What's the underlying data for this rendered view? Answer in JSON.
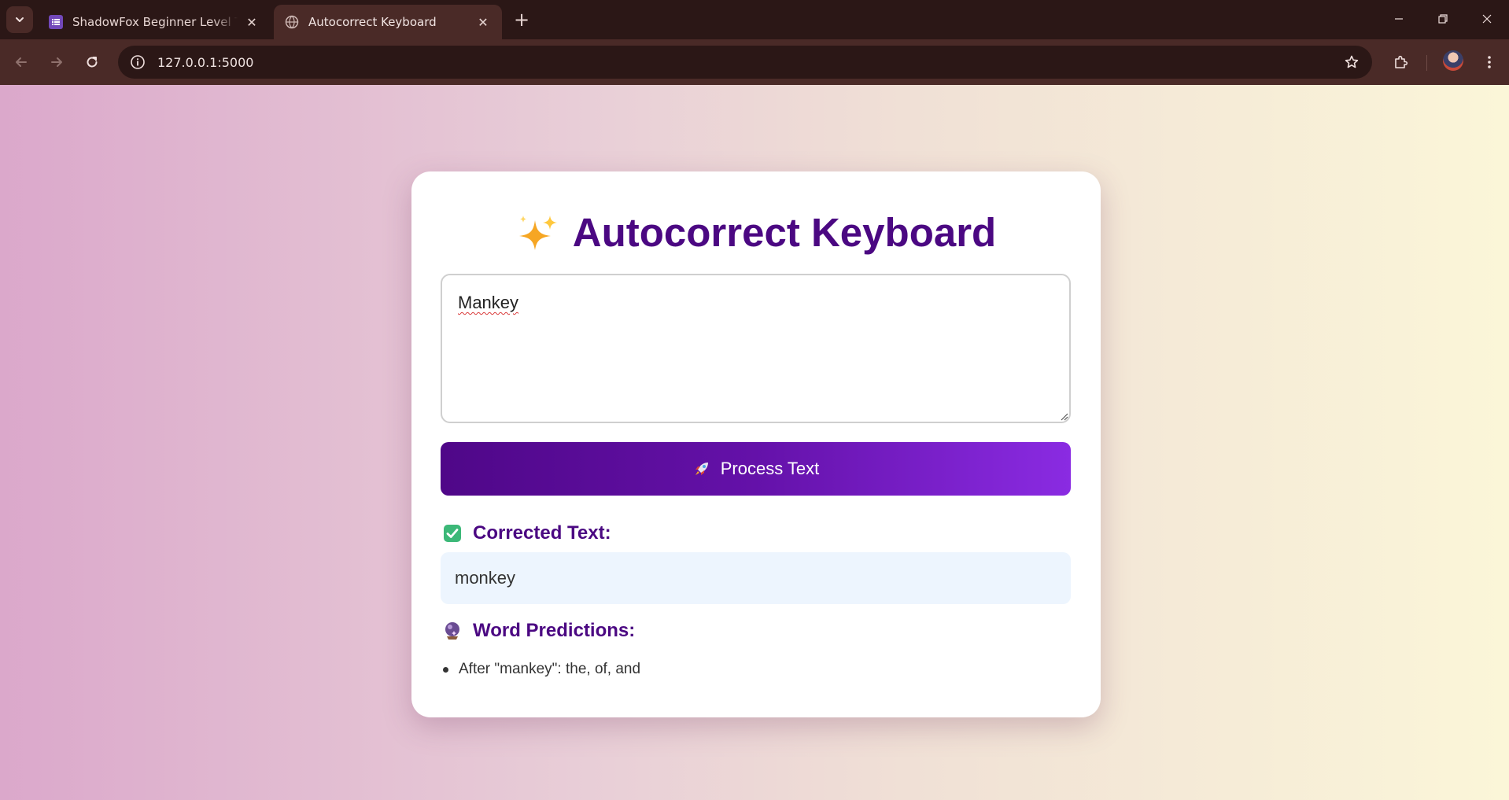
{
  "browser": {
    "tabs": [
      {
        "title": "ShadowFox Beginner Level Task",
        "active": false,
        "icon": "forms-icon"
      },
      {
        "title": "Autocorrect Keyboard",
        "active": true,
        "icon": "globe-icon"
      }
    ],
    "address": "127.0.0.1:5000"
  },
  "app": {
    "title": "Autocorrect Keyboard",
    "title_icon": "sparkles-icon",
    "input_value": "Mankey",
    "process_button_label": "Process Text",
    "process_button_icon": "rocket-icon",
    "corrected_heading": "Corrected Text:",
    "corrected_icon": "check-mark-icon",
    "corrected_text": "monkey",
    "predictions_heading": "Word Predictions:",
    "predictions_icon": "crystal-ball-icon",
    "predictions": [
      "After \"mankey\": the, of, and"
    ]
  },
  "colors": {
    "accent": "#4b0882",
    "button_start": "#4f0788",
    "button_end": "#8a2be2",
    "result_bg": "#edf5fe"
  }
}
